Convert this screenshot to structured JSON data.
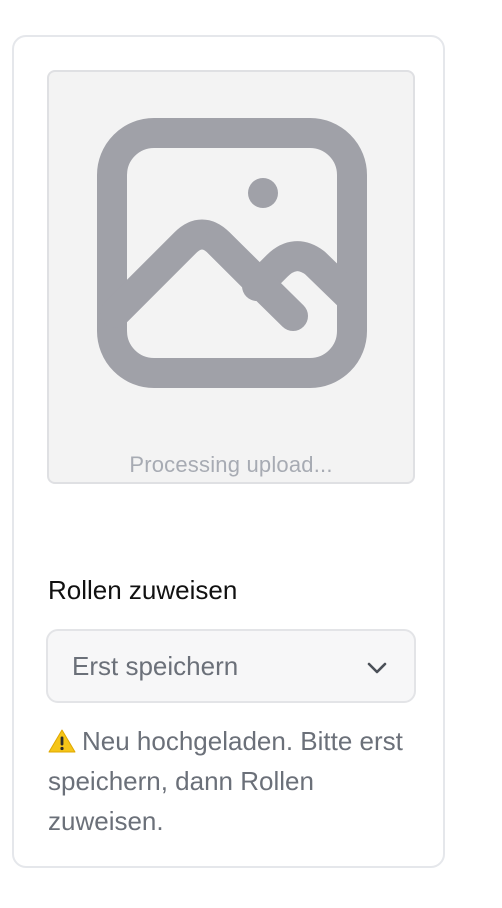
{
  "upload": {
    "status_text": "Processing upload..."
  },
  "roles": {
    "label": "Rollen zuweisen",
    "select_value": "Erst speichern",
    "warning_text": "Neu hochgeladen. Bitte erst speichern, dann Rollen zuweisen."
  },
  "icons": {
    "placeholder": "image-placeholder-icon",
    "chevron": "chevron-down-icon",
    "warning": "warning-icon"
  },
  "colors": {
    "icon_gray": "#a0a1a8",
    "warning_yellow": "#f5c518"
  }
}
